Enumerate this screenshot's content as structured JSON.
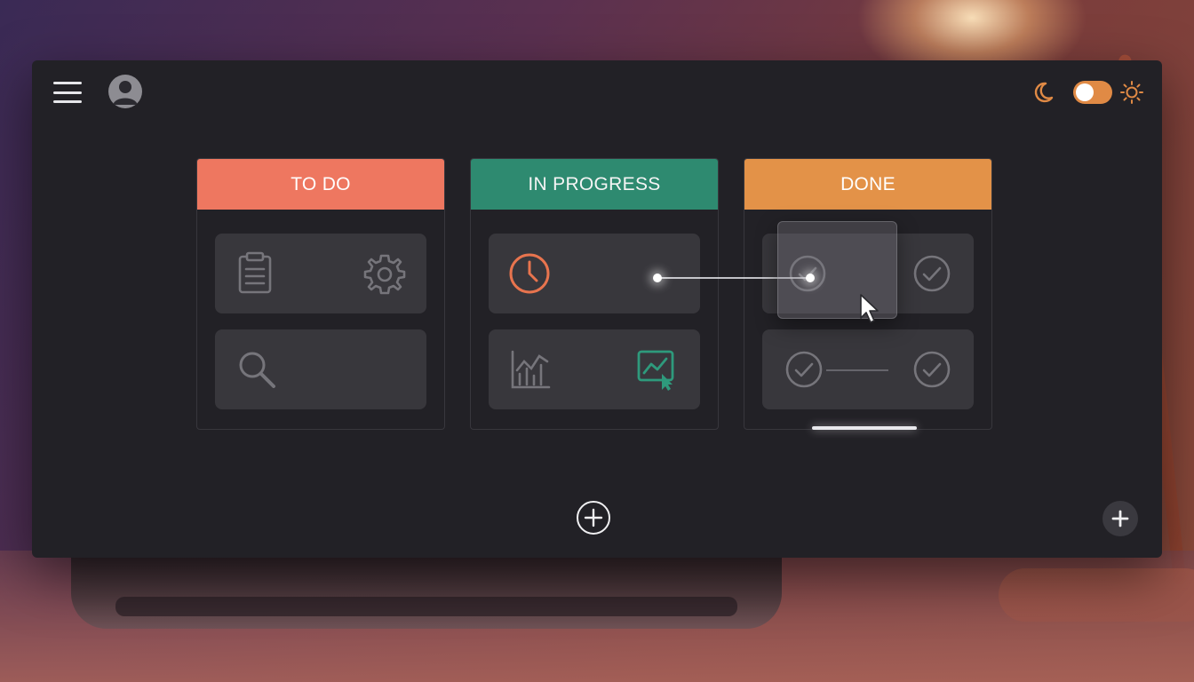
{
  "window": {
    "menu_icon": "hamburger-menu-icon",
    "avatar_icon": "user-avatar-icon",
    "theme": {
      "moon_icon": "moon-icon",
      "sun_icon": "sun-icon",
      "toggle_state": "on",
      "accent_color": "#e08a45"
    }
  },
  "board": {
    "columns": [
      {
        "title": "TO DO",
        "color": "#ee7760",
        "cards": [
          {
            "icons": [
              "clipboard-icon",
              "gear-icon"
            ]
          },
          {
            "icons": [
              "search-icon"
            ]
          }
        ]
      },
      {
        "title": "IN PROGRESS",
        "color": "#2e8a70",
        "cards": [
          {
            "icons": [
              "clock-icon"
            ]
          },
          {
            "icons": [
              "bar-chart-icon",
              "line-chart-cursor-icon"
            ]
          }
        ]
      },
      {
        "title": "DONE",
        "color": "#e39248",
        "cards": [
          {
            "icons": [
              "check-circle-icon",
              "check-circle-icon"
            ]
          },
          {
            "icons": [
              "check-circle-icon",
              "check-circle-icon"
            ]
          }
        ]
      }
    ]
  },
  "drag": {
    "cursor_icon": "pointer-cursor-icon"
  },
  "actions": {
    "add_center_icon": "plus-circle-icon",
    "add_corner_icon": "plus-icon"
  }
}
